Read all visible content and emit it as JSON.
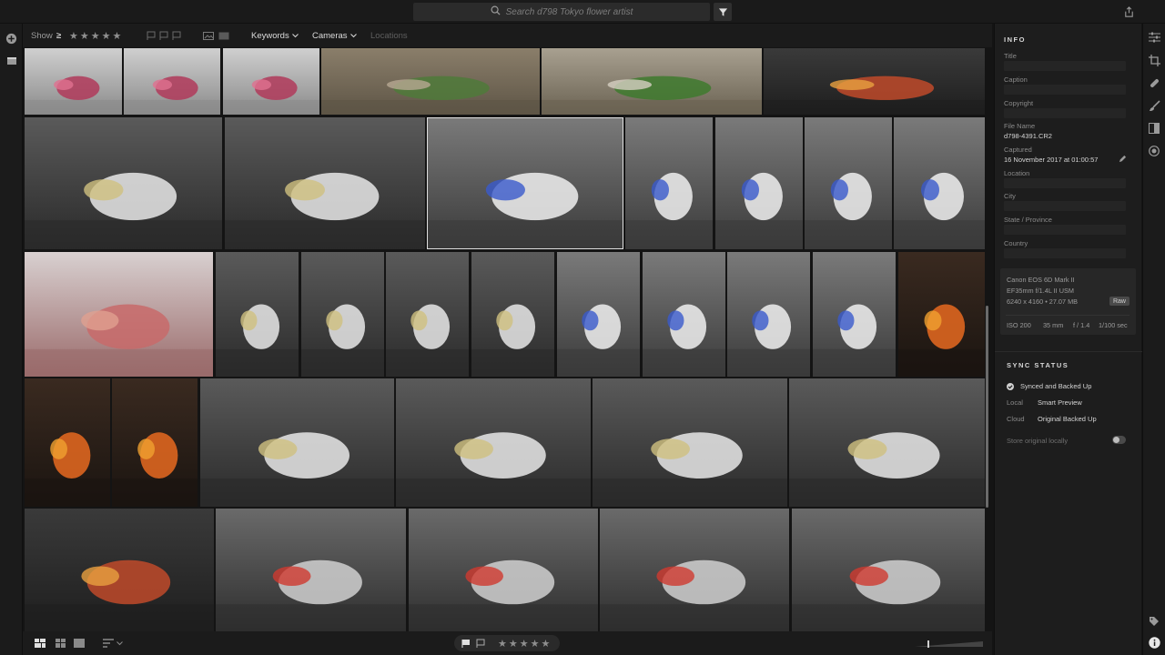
{
  "search": {
    "placeholder": "Search d798 Tokyo flower artist"
  },
  "filterbar": {
    "show_label": "Show",
    "operator": "≥",
    "stars": "★★★★★",
    "keywords_label": "Keywords",
    "cameras_label": "Cameras",
    "locations_label": "Locations"
  },
  "bottombar": {
    "stars": "★★★★★"
  },
  "info": {
    "section_title": "INFO",
    "title_label": "Title",
    "caption_label": "Caption",
    "copyright_label": "Copyright",
    "filename_label": "File Name",
    "filename_value": "d798-4391.CR2",
    "captured_label": "Captured",
    "captured_value": "16 November 2017 at 01:00:57",
    "location_label": "Location",
    "city_label": "City",
    "state_label": "State / Province",
    "country_label": "Country",
    "camera": {
      "model": "Canon EOS 6D Mark II",
      "lens": "EF35mm f/1.4L II USM",
      "size": "6240 x 4160 • 27.07 MB",
      "raw_badge": "Raw",
      "iso": "ISO 200",
      "focal": "35 mm",
      "aperture": "f / 1.4",
      "shutter": "1/100 sec"
    },
    "sync_title": "SYNC STATUS",
    "sync_status": "Synced and Backed Up",
    "local_label": "Local",
    "local_value": "Smart Preview",
    "cloud_label": "Cloud",
    "cloud_value": "Original Backed Up",
    "store_local_label": "Store original locally",
    "store_local_on": false
  },
  "colors": {
    "bg": "#141414",
    "panel": "#1d1d1d",
    "accent_green": "#6fa84a"
  },
  "photos": [
    {
      "name": "photo-vase-1",
      "tone": "vase"
    },
    {
      "name": "photo-vase-2",
      "tone": "vase"
    },
    {
      "name": "photo-vase-3",
      "tone": "vase"
    },
    {
      "name": "photo-table-stems-1",
      "tone": "stems"
    },
    {
      "name": "photo-table-stems-2",
      "tone": "stems-green"
    },
    {
      "name": "photo-florist-hands",
      "tone": "dark"
    },
    {
      "name": "photo-blonde-florist-1",
      "tone": "shop"
    },
    {
      "name": "photo-blonde-florist-2",
      "tone": "shop"
    },
    {
      "name": "photo-arrangement-selected",
      "tone": "arrange"
    },
    {
      "name": "photo-arrangement-a",
      "tone": "arrange"
    },
    {
      "name": "photo-arrangement-b",
      "tone": "arrange"
    },
    {
      "name": "photo-arrangement-c",
      "tone": "arrange"
    },
    {
      "name": "photo-arrangement-d",
      "tone": "arrange"
    },
    {
      "name": "photo-hydrangea",
      "tone": "hydrangea"
    },
    {
      "name": "photo-chef-arr-1",
      "tone": "shop"
    },
    {
      "name": "photo-chef-arr-2",
      "tone": "shop"
    },
    {
      "name": "photo-chef-arr-3",
      "tone": "shop"
    },
    {
      "name": "photo-chef-arr-4",
      "tone": "shop"
    },
    {
      "name": "photo-arr-tools-1",
      "tone": "arrange"
    },
    {
      "name": "photo-arr-tools-2",
      "tone": "arrange"
    },
    {
      "name": "photo-arr-tools-3",
      "tone": "arrange"
    },
    {
      "name": "photo-arr-tools-4",
      "tone": "arrange"
    },
    {
      "name": "photo-orange-bouquet",
      "tone": "orange"
    },
    {
      "name": "photo-lilies-1",
      "tone": "orange"
    },
    {
      "name": "photo-lilies-2",
      "tone": "orange"
    },
    {
      "name": "photo-workshop-1",
      "tone": "shop"
    },
    {
      "name": "photo-workshop-2",
      "tone": "shop"
    },
    {
      "name": "photo-workshop-3",
      "tone": "shop"
    },
    {
      "name": "photo-workshop-4",
      "tone": "shop"
    },
    {
      "name": "photo-group-1",
      "tone": "dark"
    },
    {
      "name": "photo-interview-1",
      "tone": "people"
    },
    {
      "name": "photo-interview-2",
      "tone": "people"
    },
    {
      "name": "photo-interview-3",
      "tone": "people"
    },
    {
      "name": "photo-interview-4",
      "tone": "people"
    }
  ]
}
